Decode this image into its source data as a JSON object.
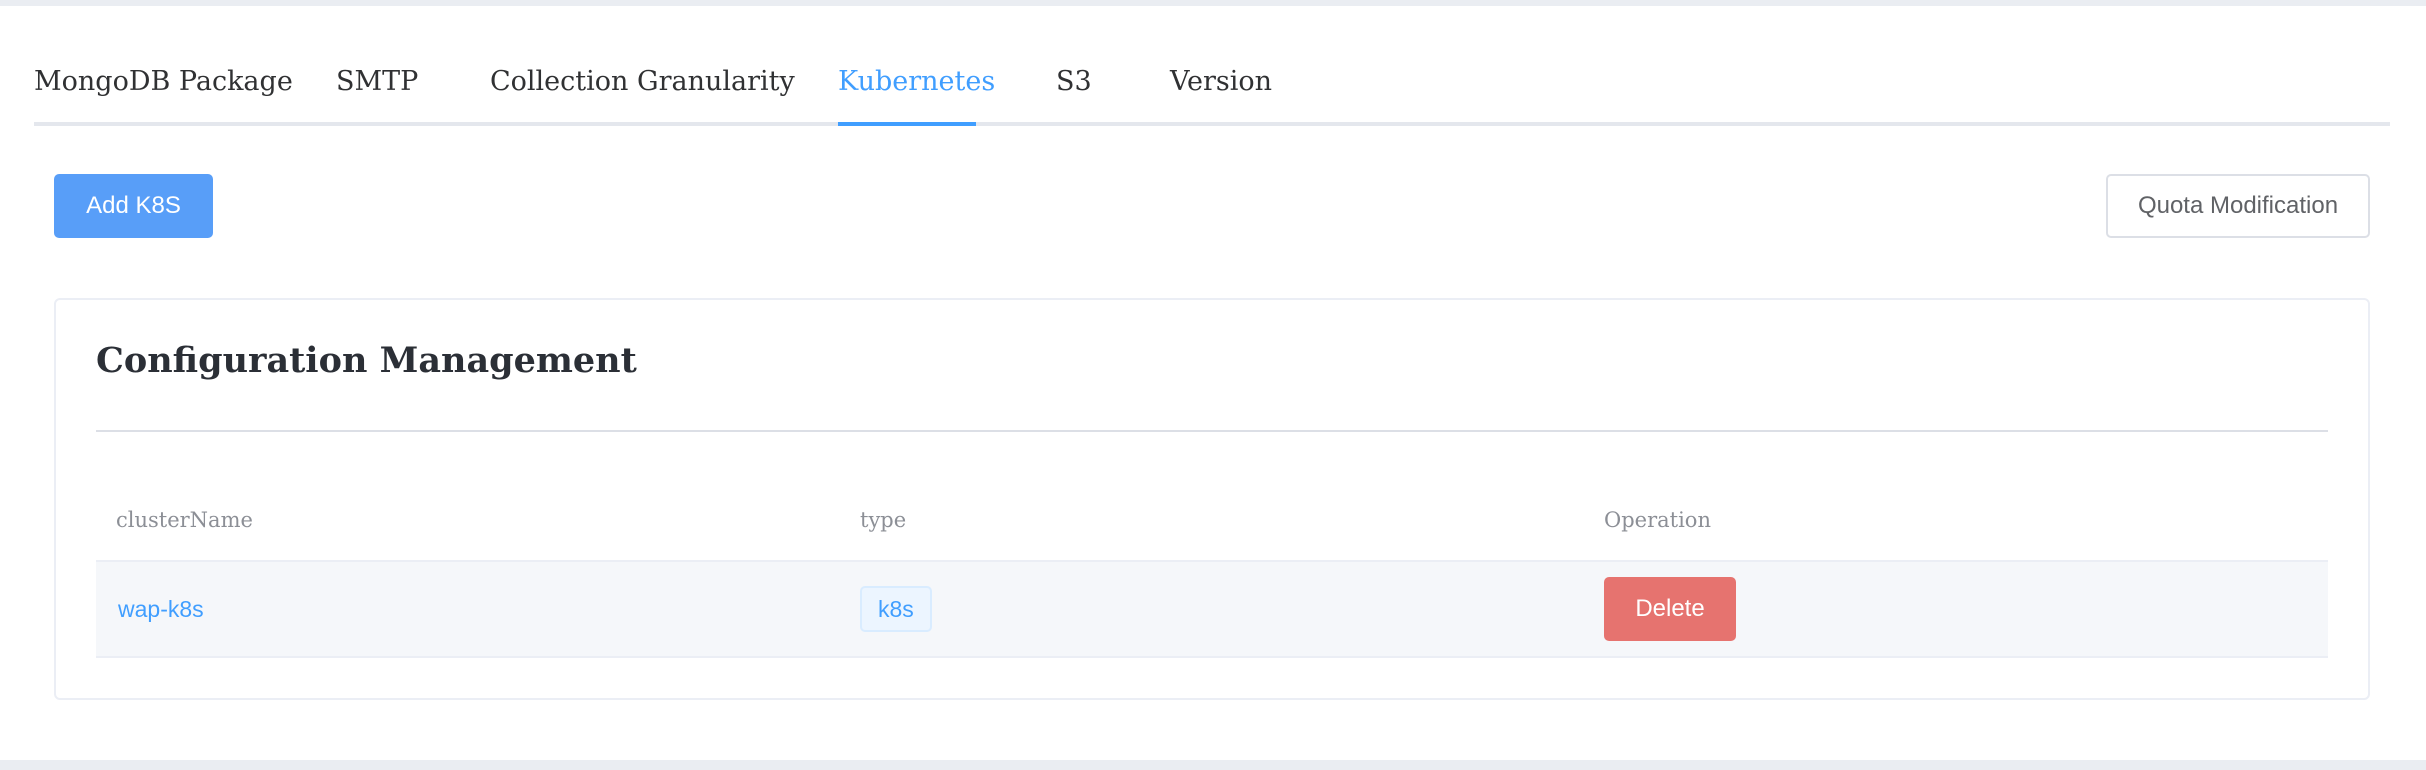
{
  "tabs": [
    {
      "label": "MongoDB Package",
      "active": false
    },
    {
      "label": "SMTP",
      "active": false
    },
    {
      "label": "Collection Granularity",
      "active": false
    },
    {
      "label": "Kubernetes",
      "active": true
    },
    {
      "label": "S3",
      "active": false
    },
    {
      "label": "Version",
      "active": false
    }
  ],
  "toolbar": {
    "add_label": "Add K8S",
    "quota_label": "Quota Modification"
  },
  "card": {
    "title": "Configuration Management",
    "columns": [
      "clusterName",
      "type",
      "Operation"
    ],
    "rows": [
      {
        "cluster_name": "wap-k8s",
        "type": "k8s",
        "operation_label": "Delete"
      }
    ]
  },
  "colors": {
    "accent": "#409eff",
    "primary_button": "#589ef8",
    "danger_button": "#e6736f",
    "row_background": "#f5f7fa"
  }
}
